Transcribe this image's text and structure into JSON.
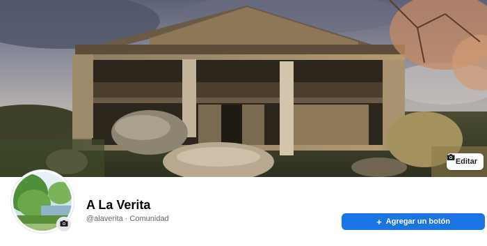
{
  "cover": {
    "image_description": "cover photo",
    "edit_label": "Editar",
    "edit_icon": "camera-icon"
  },
  "profile": {
    "name": "A La Verita",
    "handle": "@alaverita",
    "separator": "·",
    "category": "Comunidad",
    "avatar_icon": "camera-icon"
  },
  "actions": {
    "add_button_icon": "plus-icon",
    "add_button_label": "Agregar un botón"
  },
  "colors": {
    "primary_button": "#1b74e4",
    "name_text": "#050505",
    "secondary_text": "#65676b"
  }
}
